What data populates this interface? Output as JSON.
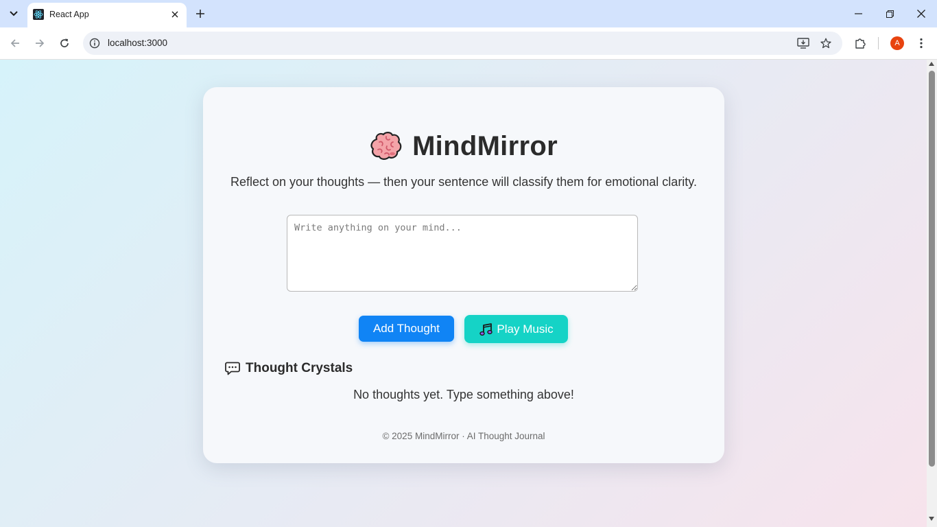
{
  "browser": {
    "tab_title": "React App",
    "url": "localhost:3000",
    "profile_initial": "A"
  },
  "app": {
    "title": "MindMirror",
    "subtitle": "Reflect on your thoughts — then your sentence will classify them for emotional clarity.",
    "input": {
      "placeholder": "Write anything on your mind...",
      "value": ""
    },
    "add_button_label": "Add Thought",
    "music_button_label": "Play Music",
    "section_title": "Thought Crystals",
    "empty_message": "No thoughts yet. Type something above!",
    "footer": "© 2025 MindMirror · AI Thought Journal"
  },
  "colors": {
    "add_button": "#1084f5",
    "music_button": "#15d3c6",
    "tabstrip": "#d3e3fd",
    "avatar": "#e8430f"
  },
  "icons": [
    "tab-search-icon",
    "react-favicon-icon",
    "close-icon",
    "plus-icon",
    "minimize-icon",
    "restore-icon",
    "back-icon",
    "forward-icon",
    "reload-icon",
    "info-icon",
    "install-icon",
    "star-icon",
    "extensions-icon",
    "menu-icon",
    "brain-icon",
    "music-note-icon",
    "chat-bubble-icon"
  ]
}
